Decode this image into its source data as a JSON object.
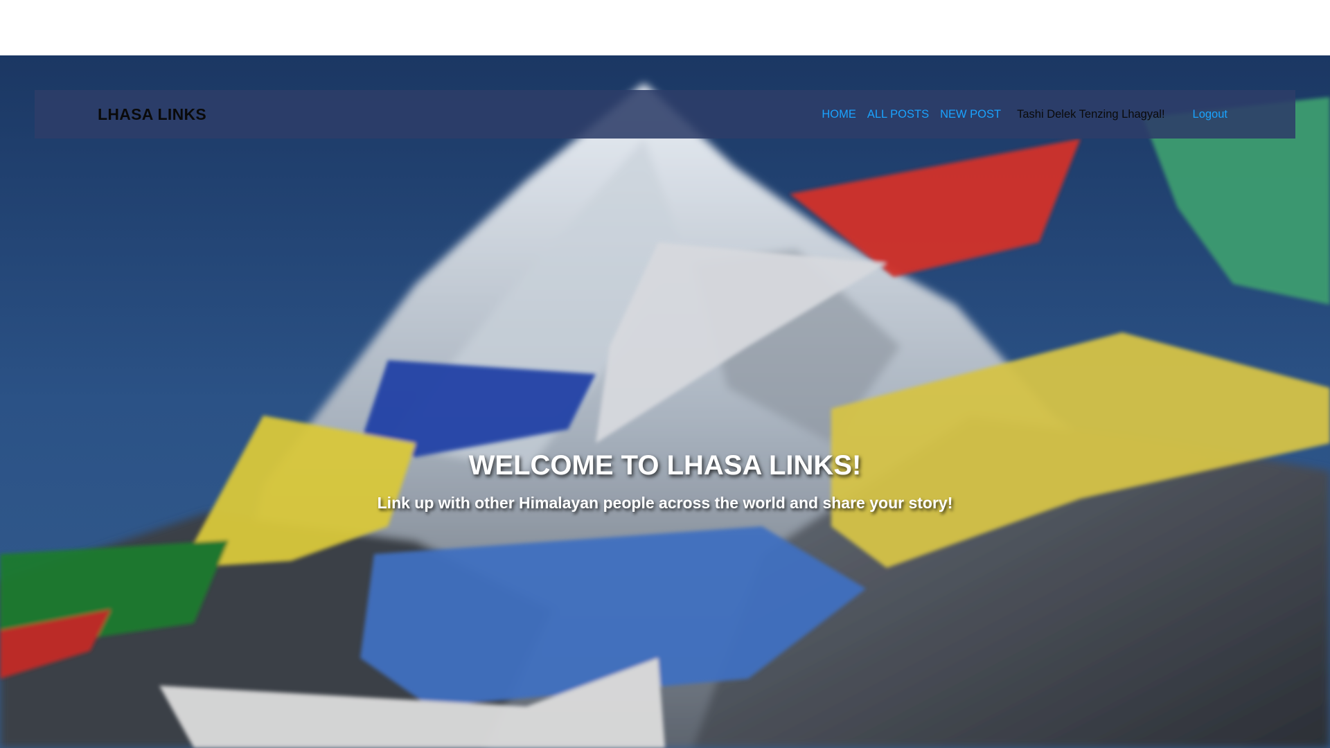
{
  "navbar": {
    "brand": "LHASA LINKS",
    "links": {
      "home": "HOME",
      "all_posts": "ALL POSTS",
      "new_post": "NEW POST"
    },
    "greeting": "Tashi Delek Tenzing Lhagyal!",
    "logout": "Logout"
  },
  "hero": {
    "title": "WELCOME TO LHASA LINKS!",
    "subtitle": "Link up with other Himalayan people across the world and share your story!",
    "background_image": "mountain-prayer-flags-photo"
  },
  "colors": {
    "navbar_bg": "#2e3e69",
    "link": "#1aa3ff",
    "brand_text": "#0a0a0a",
    "hero_text": "#ffffff"
  }
}
